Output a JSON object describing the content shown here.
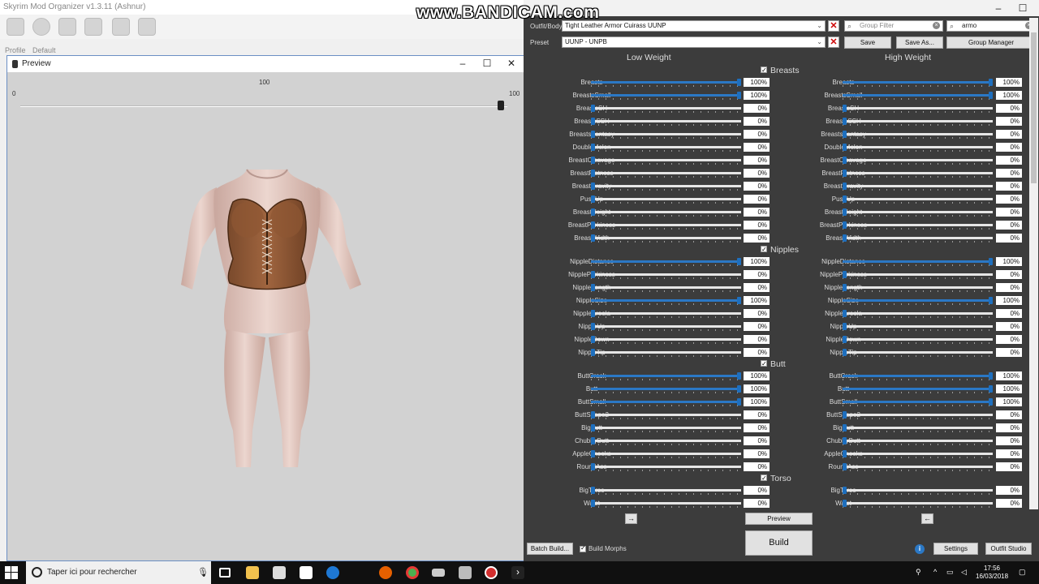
{
  "watermark": "www.BANDICAM.com",
  "mo": {
    "title": "Skyrim Mod Organizer v1.3.11 (Ashnur)",
    "profile_label": "Profile",
    "profile_value": "Default"
  },
  "preview": {
    "title": "Preview",
    "slider_mid": "100",
    "slider_min": "0",
    "slider_max": "100",
    "slider_value_fraction": 1.0
  },
  "bodyslide": {
    "outfit_label": "Outfit/Body",
    "outfit_value": "Tight Leather Armor Cuirass UUNP",
    "preset_label": "Preset",
    "preset_value": "UUNP - UNPB",
    "group_filter_placeholder": "Group Filter",
    "outfit_filter_value": "armo",
    "save_label": "Save",
    "save_as_label": "Save As...",
    "group_manager_label": "Group Manager",
    "low_weight_label": "Low Weight",
    "high_weight_label": "High Weight",
    "categories": [
      {
        "name": "Breasts",
        "sliders": [
          {
            "name": "Breasts",
            "low": "100%",
            "high": "100%"
          },
          {
            "name": "BreastsSmall",
            "low": "100%",
            "high": "100%"
          },
          {
            "name": "BreastsSH",
            "low": "0%",
            "high": "0%"
          },
          {
            "name": "BreastsSSH",
            "low": "0%",
            "high": "0%"
          },
          {
            "name": "BreastsFantasy",
            "low": "0%",
            "high": "0%"
          },
          {
            "name": "DoubleMelon",
            "low": "0%",
            "high": "0%"
          },
          {
            "name": "BreastCleavage",
            "low": "0%",
            "high": "0%"
          },
          {
            "name": "BreastFlatness",
            "low": "0%",
            "high": "0%"
          },
          {
            "name": "BreastGravity",
            "low": "0%",
            "high": "0%"
          },
          {
            "name": "PushUp",
            "low": "0%",
            "high": "0%"
          },
          {
            "name": "BreastHeight",
            "low": "0%",
            "high": "0%"
          },
          {
            "name": "BreastPerkiness",
            "low": "0%",
            "high": "0%"
          },
          {
            "name": "BreastWidth",
            "low": "0%",
            "high": "0%"
          }
        ]
      },
      {
        "name": "Nipples",
        "sliders": [
          {
            "name": "NippleDistance",
            "low": "100%",
            "high": "100%"
          },
          {
            "name": "NipplePerkiness",
            "low": "0%",
            "high": "0%"
          },
          {
            "name": "NippleLength",
            "low": "0%",
            "high": "0%"
          },
          {
            "name": "NippleSize",
            "low": "100%",
            "high": "100%"
          },
          {
            "name": "NippleAreola",
            "low": "0%",
            "high": "0%"
          },
          {
            "name": "NippleUp",
            "low": "0%",
            "high": "0%"
          },
          {
            "name": "NippleDown",
            "low": "0%",
            "high": "0%"
          },
          {
            "name": "NippleTip",
            "low": "0%",
            "high": "0%"
          }
        ]
      },
      {
        "name": "Butt",
        "sliders": [
          {
            "name": "ButtCrack",
            "low": "100%",
            "high": "100%"
          },
          {
            "name": "Butt",
            "low": "100%",
            "high": "100%"
          },
          {
            "name": "ButtSmall",
            "low": "100%",
            "high": "100%"
          },
          {
            "name": "ButtShape2",
            "low": "0%",
            "high": "0%"
          },
          {
            "name": "BigButt",
            "low": "0%",
            "high": "0%"
          },
          {
            "name": "ChubbyButt",
            "low": "0%",
            "high": "0%"
          },
          {
            "name": "AppleCheeks",
            "low": "0%",
            "high": "0%"
          },
          {
            "name": "RoundAss",
            "low": "0%",
            "high": "0%"
          }
        ]
      },
      {
        "name": "Torso",
        "sliders": [
          {
            "name": "BigTorso",
            "low": "0%",
            "high": "0%"
          },
          {
            "name": "Waist",
            "low": "0%",
            "high": "0%"
          }
        ]
      }
    ],
    "arrow_right": "→",
    "arrow_left": "←",
    "preview_label": "Preview",
    "build_label": "Build",
    "batch_build_label": "Batch Build...",
    "build_morphs_label": "Build Morphs",
    "settings_label": "Settings",
    "outfit_studio_label": "Outfit Studio"
  },
  "taskbar": {
    "search_placeholder": "Taper ici pour rechercher",
    "time": "17:56",
    "date": "16/03/2018"
  }
}
